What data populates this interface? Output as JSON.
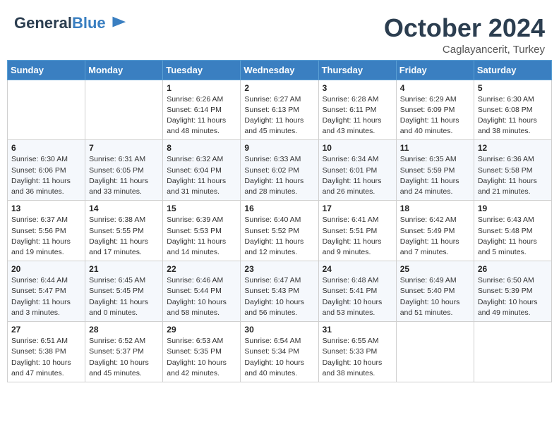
{
  "header": {
    "logo_line1": "General",
    "logo_line2": "Blue",
    "month": "October 2024",
    "location": "Caglayancerit, Turkey"
  },
  "days_of_week": [
    "Sunday",
    "Monday",
    "Tuesday",
    "Wednesday",
    "Thursday",
    "Friday",
    "Saturday"
  ],
  "weeks": [
    [
      {
        "day": "",
        "info": ""
      },
      {
        "day": "",
        "info": ""
      },
      {
        "day": "1",
        "info": "Sunrise: 6:26 AM\nSunset: 6:14 PM\nDaylight: 11 hours and 48 minutes."
      },
      {
        "day": "2",
        "info": "Sunrise: 6:27 AM\nSunset: 6:13 PM\nDaylight: 11 hours and 45 minutes."
      },
      {
        "day": "3",
        "info": "Sunrise: 6:28 AM\nSunset: 6:11 PM\nDaylight: 11 hours and 43 minutes."
      },
      {
        "day": "4",
        "info": "Sunrise: 6:29 AM\nSunset: 6:09 PM\nDaylight: 11 hours and 40 minutes."
      },
      {
        "day": "5",
        "info": "Sunrise: 6:30 AM\nSunset: 6:08 PM\nDaylight: 11 hours and 38 minutes."
      }
    ],
    [
      {
        "day": "6",
        "info": "Sunrise: 6:30 AM\nSunset: 6:06 PM\nDaylight: 11 hours and 36 minutes."
      },
      {
        "day": "7",
        "info": "Sunrise: 6:31 AM\nSunset: 6:05 PM\nDaylight: 11 hours and 33 minutes."
      },
      {
        "day": "8",
        "info": "Sunrise: 6:32 AM\nSunset: 6:04 PM\nDaylight: 11 hours and 31 minutes."
      },
      {
        "day": "9",
        "info": "Sunrise: 6:33 AM\nSunset: 6:02 PM\nDaylight: 11 hours and 28 minutes."
      },
      {
        "day": "10",
        "info": "Sunrise: 6:34 AM\nSunset: 6:01 PM\nDaylight: 11 hours and 26 minutes."
      },
      {
        "day": "11",
        "info": "Sunrise: 6:35 AM\nSunset: 5:59 PM\nDaylight: 11 hours and 24 minutes."
      },
      {
        "day": "12",
        "info": "Sunrise: 6:36 AM\nSunset: 5:58 PM\nDaylight: 11 hours and 21 minutes."
      }
    ],
    [
      {
        "day": "13",
        "info": "Sunrise: 6:37 AM\nSunset: 5:56 PM\nDaylight: 11 hours and 19 minutes."
      },
      {
        "day": "14",
        "info": "Sunrise: 6:38 AM\nSunset: 5:55 PM\nDaylight: 11 hours and 17 minutes."
      },
      {
        "day": "15",
        "info": "Sunrise: 6:39 AM\nSunset: 5:53 PM\nDaylight: 11 hours and 14 minutes."
      },
      {
        "day": "16",
        "info": "Sunrise: 6:40 AM\nSunset: 5:52 PM\nDaylight: 11 hours and 12 minutes."
      },
      {
        "day": "17",
        "info": "Sunrise: 6:41 AM\nSunset: 5:51 PM\nDaylight: 11 hours and 9 minutes."
      },
      {
        "day": "18",
        "info": "Sunrise: 6:42 AM\nSunset: 5:49 PM\nDaylight: 11 hours and 7 minutes."
      },
      {
        "day": "19",
        "info": "Sunrise: 6:43 AM\nSunset: 5:48 PM\nDaylight: 11 hours and 5 minutes."
      }
    ],
    [
      {
        "day": "20",
        "info": "Sunrise: 6:44 AM\nSunset: 5:47 PM\nDaylight: 11 hours and 3 minutes."
      },
      {
        "day": "21",
        "info": "Sunrise: 6:45 AM\nSunset: 5:45 PM\nDaylight: 11 hours and 0 minutes."
      },
      {
        "day": "22",
        "info": "Sunrise: 6:46 AM\nSunset: 5:44 PM\nDaylight: 10 hours and 58 minutes."
      },
      {
        "day": "23",
        "info": "Sunrise: 6:47 AM\nSunset: 5:43 PM\nDaylight: 10 hours and 56 minutes."
      },
      {
        "day": "24",
        "info": "Sunrise: 6:48 AM\nSunset: 5:41 PM\nDaylight: 10 hours and 53 minutes."
      },
      {
        "day": "25",
        "info": "Sunrise: 6:49 AM\nSunset: 5:40 PM\nDaylight: 10 hours and 51 minutes."
      },
      {
        "day": "26",
        "info": "Sunrise: 6:50 AM\nSunset: 5:39 PM\nDaylight: 10 hours and 49 minutes."
      }
    ],
    [
      {
        "day": "27",
        "info": "Sunrise: 6:51 AM\nSunset: 5:38 PM\nDaylight: 10 hours and 47 minutes."
      },
      {
        "day": "28",
        "info": "Sunrise: 6:52 AM\nSunset: 5:37 PM\nDaylight: 10 hours and 45 minutes."
      },
      {
        "day": "29",
        "info": "Sunrise: 6:53 AM\nSunset: 5:35 PM\nDaylight: 10 hours and 42 minutes."
      },
      {
        "day": "30",
        "info": "Sunrise: 6:54 AM\nSunset: 5:34 PM\nDaylight: 10 hours and 40 minutes."
      },
      {
        "day": "31",
        "info": "Sunrise: 6:55 AM\nSunset: 5:33 PM\nDaylight: 10 hours and 38 minutes."
      },
      {
        "day": "",
        "info": ""
      },
      {
        "day": "",
        "info": ""
      }
    ]
  ]
}
